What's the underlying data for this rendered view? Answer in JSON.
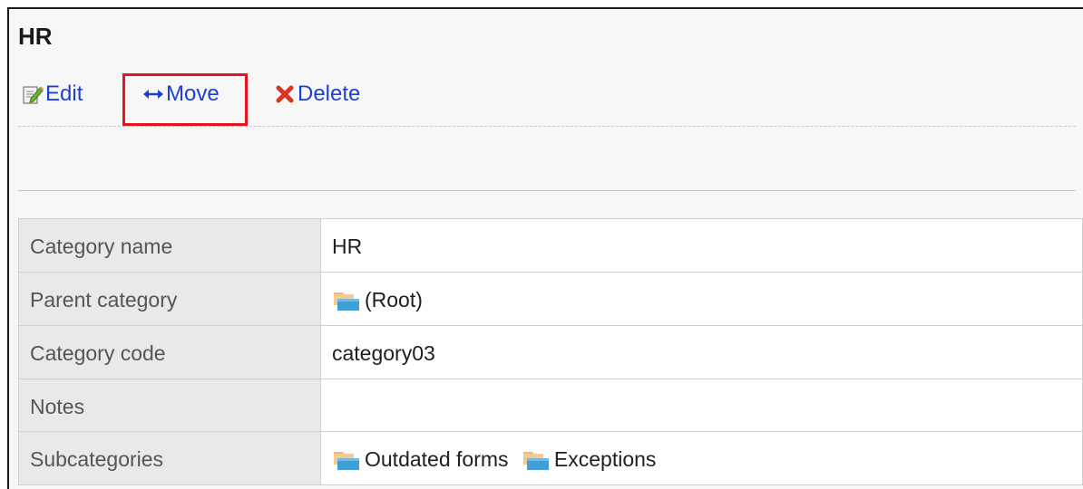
{
  "category": {
    "title": "HR"
  },
  "actions": {
    "edit_label": "Edit",
    "move_label": "Move",
    "delete_label": "Delete"
  },
  "details": {
    "rows": [
      {
        "label": "Category name",
        "value": "HR"
      },
      {
        "label": "Parent category",
        "value": "(Root)",
        "icon": "folder-icon"
      },
      {
        "label": "Category code",
        "value": "category03"
      },
      {
        "label": "Notes",
        "value": ""
      },
      {
        "label": "Subcategories",
        "items": [
          "Outdated forms",
          "Exceptions"
        ],
        "icon": "folder-icon"
      }
    ]
  },
  "colors": {
    "link": "#1d3fd6",
    "highlight": "#e8121d",
    "header_cell": "#e9e9e9",
    "panel": "#f7f7f7"
  }
}
